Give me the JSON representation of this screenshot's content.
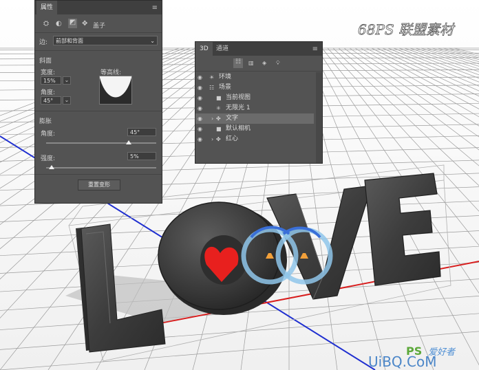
{
  "props": {
    "tab": "属性",
    "mode_label": "盖子",
    "side_label": "边:",
    "side_value": "前部和背面",
    "bevel_title": "斜面",
    "width_label": "宽度:",
    "width_value": "15%",
    "angle_label": "角度:",
    "angle_value": "45°",
    "contour_label": "等高线:",
    "inflate_title": "膨胀",
    "inflate_angle_label": "角度:",
    "inflate_angle_value": "45°",
    "inflate_angle_level": 0.75,
    "strength_label": "强度:",
    "strength_value": "5%",
    "strength_level": 0.05,
    "reset_label": "重置变形"
  },
  "panel3d": {
    "tab1": "3D",
    "tab2": "通道",
    "layers": [
      {
        "label": "环境",
        "icon": "environment-icon"
      },
      {
        "label": "场景",
        "icon": "scene-icon"
      },
      {
        "label": "当前视图",
        "icon": "camera-icon"
      },
      {
        "label": "无限光 1",
        "icon": "light-icon"
      },
      {
        "label": "文字",
        "icon": "mesh-icon",
        "selected": true
      },
      {
        "label": "默认相机",
        "icon": "camera-icon"
      },
      {
        "label": "红心",
        "icon": "mesh-icon"
      }
    ]
  },
  "canvas": {
    "letters": [
      "L",
      "O",
      "V",
      "E"
    ],
    "watermark_top": "68PS 联盟素材",
    "watermark_bottom_ps": "PS",
    "watermark_bottom_cn": "爱好者",
    "watermark_url": "UiBQ.CoM"
  },
  "colors": {
    "panel": "#535353",
    "letter": "#444444",
    "heart": "#e8201e",
    "axis_red": "#d81e1e",
    "axis_blue": "#1f2fd0",
    "gizmo": "#8fc6ea"
  }
}
